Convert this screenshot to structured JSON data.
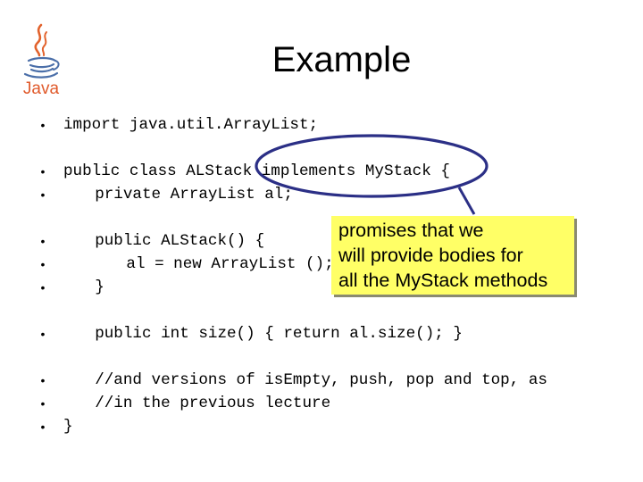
{
  "logo": {
    "icon": "java-logo-icon",
    "wordmark": "Java",
    "colors": {
      "steam": "#e2622c",
      "cup": "#4b6fa9",
      "wordmark": "#e05a2b"
    }
  },
  "slide": {
    "title": "Example"
  },
  "code_lines": [
    {
      "bullet": "•",
      "indent": 0,
      "text": "import java.util.ArrayList;"
    },
    {
      "bullet": "•",
      "indent": 0,
      "text": "public class ALStack implements MyStack {"
    },
    {
      "bullet": "•",
      "indent": 1,
      "text": "private ArrayList al;"
    },
    {
      "bullet": "•",
      "indent": 1,
      "text": "public ALStack() {"
    },
    {
      "bullet": "•",
      "indent": 2,
      "text": "al = new ArrayList ();"
    },
    {
      "bullet": "•",
      "indent": 1,
      "text": "}"
    },
    {
      "bullet": "•",
      "indent": 1,
      "text": "public int size() { return al.size(); }"
    },
    {
      "bullet": "•",
      "indent": 1,
      "text": "//and versions of isEmpty, push, pop and top, as"
    },
    {
      "bullet": "•",
      "indent": 1,
      "text": "//in the previous lecture"
    },
    {
      "bullet": "•",
      "indent": 0,
      "text": "}"
    }
  ],
  "annotation": {
    "highlight_target": "implements MyStack {",
    "highlight_color": "#2b2f86",
    "callout_lines": [
      "promises that we",
      "will provide bodies for",
      "all the MyStack methods"
    ],
    "callout_fill": "#ffff66"
  }
}
